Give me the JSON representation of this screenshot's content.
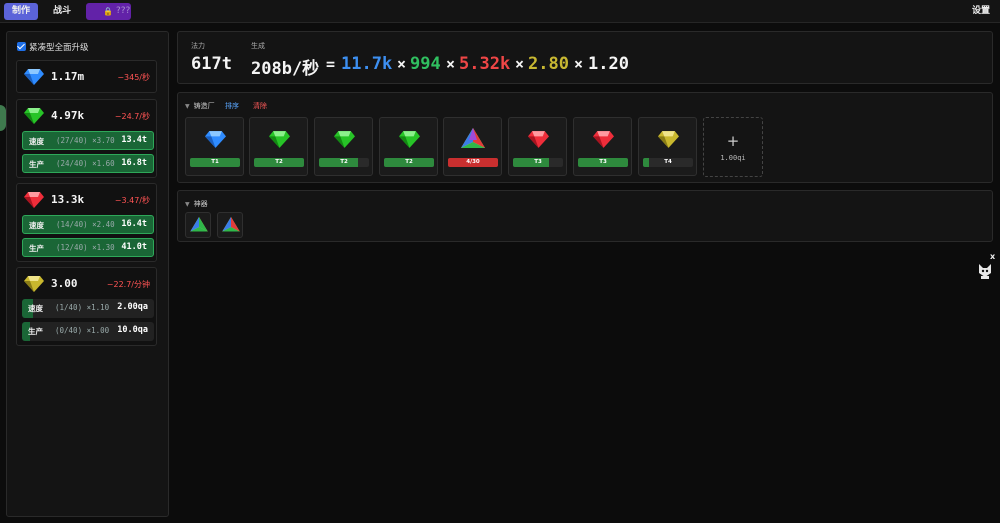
{
  "tabs": {
    "make": "制作",
    "fight": "战斗",
    "locked": "???",
    "settings": "设置"
  },
  "sidebar": {
    "compact_label": "紧凑型全面升级",
    "gems": [
      {
        "count": "1.17m",
        "rate": "−345/秒",
        "color": "blue",
        "upgrades": []
      },
      {
        "count": "4.97k",
        "rate": "−24.7/秒",
        "color": "green",
        "upgrades": [
          {
            "label": "速度",
            "level": "(27/40)",
            "mult": "×3.70",
            "cost": "13.4t",
            "progress": 1.0
          },
          {
            "label": "生产",
            "level": "(24/40)",
            "mult": "×1.60",
            "cost": "16.8t",
            "progress": 1.0
          }
        ]
      },
      {
        "count": "13.3k",
        "rate": "−3.47/秒",
        "color": "red",
        "upgrades": [
          {
            "label": "速度",
            "level": "(14/40)",
            "mult": "×2.40",
            "cost": "16.4t",
            "progress": 1.0
          },
          {
            "label": "生产",
            "level": "(12/40)",
            "mult": "×1.30",
            "cost": "41.0t",
            "progress": 1.0
          }
        ]
      },
      {
        "count": "3.00",
        "rate": "−22.7/分钟",
        "color": "yellow",
        "upgrades": [
          {
            "label": "速度",
            "level": "(1/40)",
            "mult": "×1.10",
            "cost": "2.00qa",
            "progress": 0.08
          },
          {
            "label": "生产",
            "level": "(0/40)",
            "mult": "×1.00",
            "cost": "10.0qa",
            "progress": 0.06
          }
        ]
      }
    ]
  },
  "mana": {
    "mana_label": "法力",
    "gen_label": "生成",
    "mana_value": "617t",
    "gen_value": "208b/秒",
    "equals": "=",
    "times": "×",
    "factors": [
      {
        "value": "11.7k",
        "color": "#3d8ff0"
      },
      {
        "value": "994",
        "color": "#30c060"
      },
      {
        "value": "5.32k",
        "color": "#ef4646"
      },
      {
        "value": "2.80",
        "color": "#c8b832"
      },
      {
        "value": "1.20",
        "color": "#f4f4f4"
      }
    ]
  },
  "forge": {
    "title": "铸造厂",
    "sort": "排序",
    "clear": "清除",
    "slots": [
      {
        "gem": "blue",
        "label": "T1",
        "progress": 1.0
      },
      {
        "gem": "green",
        "label": "T2",
        "progress": 1.0
      },
      {
        "gem": "green",
        "label": "T2",
        "progress": 0.78
      },
      {
        "gem": "green",
        "label": "T2",
        "progress": 1.0
      },
      {
        "gem": "rainbow",
        "label": "4/30",
        "progress": 1.0,
        "red": true
      },
      {
        "gem": "red",
        "label": "T3",
        "progress": 0.72
      },
      {
        "gem": "red",
        "label": "T3",
        "progress": 1.0
      },
      {
        "gem": "yellow",
        "label": "T4",
        "progress": 0.12
      }
    ],
    "add_plus": "+",
    "add_cost": "1.00qi"
  },
  "artifacts": {
    "title": "神器",
    "items": [
      "rainbow-prism-icon",
      "rainbow-prism-icon"
    ]
  },
  "widget": {
    "close": "x"
  }
}
